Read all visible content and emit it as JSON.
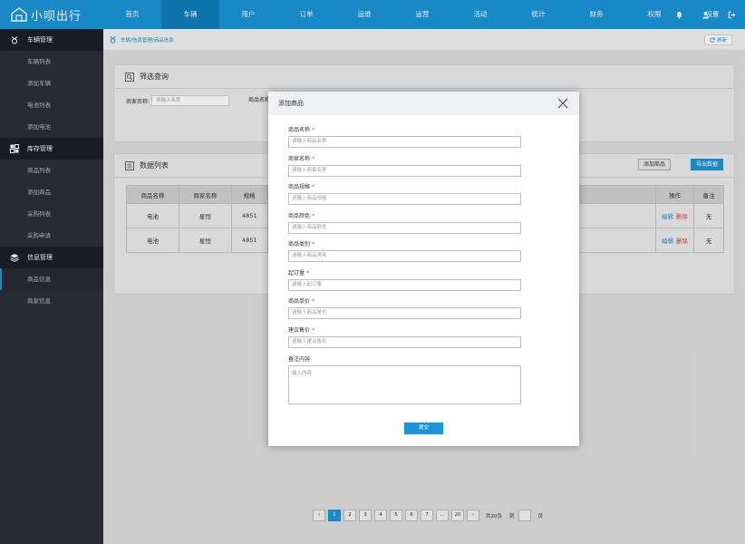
{
  "app": {
    "title": "小呗出行"
  },
  "nav": [
    "首页",
    "车辆",
    "用户",
    "订单",
    "运维",
    "运营",
    "活动",
    "统计",
    "财务",
    "权限",
    "设置"
  ],
  "sidebar": {
    "groups": [
      {
        "label": "车辆管理",
        "items": [
          "车辆列表",
          "添加车辆",
          "电池列表",
          "添加电池"
        ]
      },
      {
        "label": "库存管理",
        "items": [
          "商品列表",
          "添加商品",
          "采购列表",
          "采购申请"
        ]
      },
      {
        "label": "信息管理",
        "items": [
          "商品信息",
          "商家信息"
        ]
      }
    ]
  },
  "breadcrumb": "车辆/信息管理/商品信息",
  "refresh_label": "刷新",
  "filter": {
    "title": "筛选查询",
    "merchant_label": "商家名称:",
    "merchant_placeholder": "请输入名称",
    "product_label": "商品名称"
  },
  "list": {
    "title": "数据列表",
    "add_label": "添加商品",
    "export_label": "导出数据",
    "columns": [
      "商品名称",
      "商家名称",
      "规格",
      "操作",
      "备注"
    ],
    "rows": [
      {
        "name": "电池",
        "merchant": "星恒",
        "spec": "4851",
        "edit": "编辑",
        "del": "删除",
        "note": "无"
      },
      {
        "name": "电池",
        "merchant": "星恒",
        "spec": "4851",
        "edit": "编辑",
        "del": "删除",
        "note": "无"
      }
    ]
  },
  "pager": {
    "prev": "‹",
    "next": "›",
    "pages": [
      "1",
      "2",
      "3",
      "4",
      "5",
      "6",
      "7",
      "...",
      "20"
    ],
    "total": "共20页",
    "goto": "到",
    "page_suffix": "页"
  },
  "modal": {
    "title": "添加商品",
    "fields": [
      {
        "label": "商品名称",
        "placeholder": "请输入商品名称"
      },
      {
        "label": "商家名称",
        "placeholder": "请输入商家名称"
      },
      {
        "label": "商品规格",
        "placeholder": "请输入商品规格"
      },
      {
        "label": "商品颜色",
        "placeholder": "请输入商品颜色"
      },
      {
        "label": "商品类别",
        "placeholder": "请输入商品类别"
      },
      {
        "label": "起订量",
        "placeholder": "请输入起订量"
      },
      {
        "label": "商品单价",
        "placeholder": "请输入商品单价"
      },
      {
        "label": "建议售价",
        "placeholder": "请输入建议售价"
      }
    ],
    "required_mark": "*",
    "remark_label": "备注内容",
    "remark_placeholder": "输入内容",
    "submit_label": "提交"
  },
  "colors": {
    "primary": "#1a95d8",
    "sidebar": "#2d2e38",
    "danger": "#e0443c"
  }
}
